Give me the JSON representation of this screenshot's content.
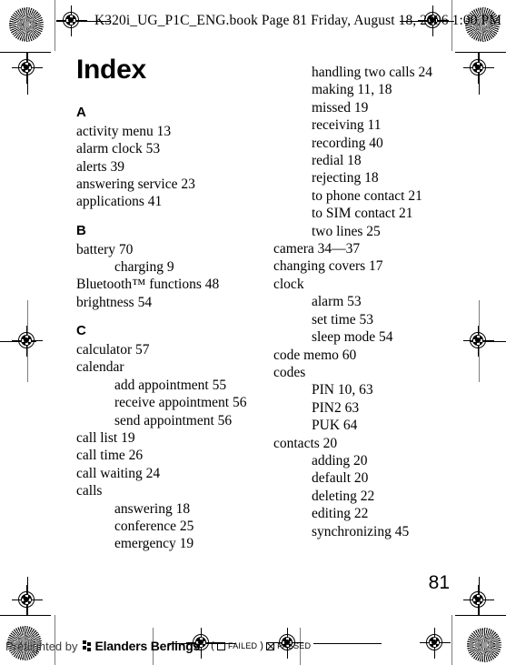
{
  "running_header": {
    "text": "K320i_UG_P1C_ENG.book  Page 81  Friday, August 18, 2006  1:00 PM"
  },
  "page": {
    "title": "Index",
    "folio": "81"
  },
  "columns": {
    "left": [
      {
        "kind": "letter",
        "text": "A"
      },
      {
        "kind": "entry",
        "level": 1,
        "text": "activity menu  13"
      },
      {
        "kind": "entry",
        "level": 1,
        "text": "alarm clock  53"
      },
      {
        "kind": "entry",
        "level": 1,
        "text": "alerts  39"
      },
      {
        "kind": "entry",
        "level": 1,
        "text": "answering service  23"
      },
      {
        "kind": "entry",
        "level": 1,
        "text": "applications  41"
      },
      {
        "kind": "letter",
        "text": "B"
      },
      {
        "kind": "entry",
        "level": 1,
        "text": "battery  70"
      },
      {
        "kind": "entry",
        "level": 2,
        "text": "charging  9"
      },
      {
        "kind": "entry",
        "level": 1,
        "text": "Bluetooth™ functions  48"
      },
      {
        "kind": "entry",
        "level": 1,
        "text": "brightness  54"
      },
      {
        "kind": "letter",
        "text": "C"
      },
      {
        "kind": "entry",
        "level": 1,
        "text": "calculator  57"
      },
      {
        "kind": "entry",
        "level": 1,
        "text": "calendar"
      },
      {
        "kind": "entry",
        "level": 2,
        "text": "add appointment  55"
      },
      {
        "kind": "entry",
        "level": 2,
        "text": "receive appointment  56"
      },
      {
        "kind": "entry",
        "level": 2,
        "text": "send appointment  56"
      },
      {
        "kind": "entry",
        "level": 1,
        "text": "call list  19"
      },
      {
        "kind": "entry",
        "level": 1,
        "text": "call time  26"
      },
      {
        "kind": "entry",
        "level": 1,
        "text": "call waiting  24"
      },
      {
        "kind": "entry",
        "level": 1,
        "text": "calls"
      },
      {
        "kind": "entry",
        "level": 2,
        "text": "answering  18"
      },
      {
        "kind": "entry",
        "level": 2,
        "text": "conference  25"
      },
      {
        "kind": "entry",
        "level": 2,
        "text": "emergency  19"
      }
    ],
    "right": [
      {
        "kind": "entry",
        "level": 2,
        "text": "handling two calls  24"
      },
      {
        "kind": "entry",
        "level": 2,
        "text": "making  11,  18"
      },
      {
        "kind": "entry",
        "level": 2,
        "text": "missed  19"
      },
      {
        "kind": "entry",
        "level": 2,
        "text": "receiving  11"
      },
      {
        "kind": "entry",
        "level": 2,
        "text": "recording  40"
      },
      {
        "kind": "entry",
        "level": 2,
        "text": "redial  18"
      },
      {
        "kind": "entry",
        "level": 2,
        "text": "rejecting  18"
      },
      {
        "kind": "entry",
        "level": 2,
        "text": "to phone contact  21"
      },
      {
        "kind": "entry",
        "level": 2,
        "text": "to SIM contact  21"
      },
      {
        "kind": "entry",
        "level": 2,
        "text": "two lines  25"
      },
      {
        "kind": "entry",
        "level": 1,
        "text": "camera  34—37"
      },
      {
        "kind": "entry",
        "level": 1,
        "text": "changing covers  17"
      },
      {
        "kind": "entry",
        "level": 1,
        "text": "clock"
      },
      {
        "kind": "entry",
        "level": 2,
        "text": "alarm  53"
      },
      {
        "kind": "entry",
        "level": 2,
        "text": "set time  53"
      },
      {
        "kind": "entry",
        "level": 2,
        "text": "sleep mode  54"
      },
      {
        "kind": "entry",
        "level": 1,
        "text": "code memo  60"
      },
      {
        "kind": "entry",
        "level": 1,
        "text": "codes"
      },
      {
        "kind": "entry",
        "level": 2,
        "text": "PIN  10,  63"
      },
      {
        "kind": "entry",
        "level": 2,
        "text": "PIN2  63"
      },
      {
        "kind": "entry",
        "level": 2,
        "text": "PUK  64"
      },
      {
        "kind": "entry",
        "level": 1,
        "text": "contacts  20"
      },
      {
        "kind": "entry",
        "level": 2,
        "text": "adding  20"
      },
      {
        "kind": "entry",
        "level": 2,
        "text": "default  20"
      },
      {
        "kind": "entry",
        "level": 2,
        "text": "deleting  22"
      },
      {
        "kind": "entry",
        "level": 2,
        "text": "editing  22"
      },
      {
        "kind": "entry",
        "level": 2,
        "text": "synchronizing  45"
      }
    ]
  },
  "preflight": {
    "by_label": "Preflighted by",
    "brand": "Elanders Berlings",
    "open_paren": "(",
    "failed_label": "FAILED",
    "close_paren": ")",
    "passed_label": "PASSED"
  }
}
